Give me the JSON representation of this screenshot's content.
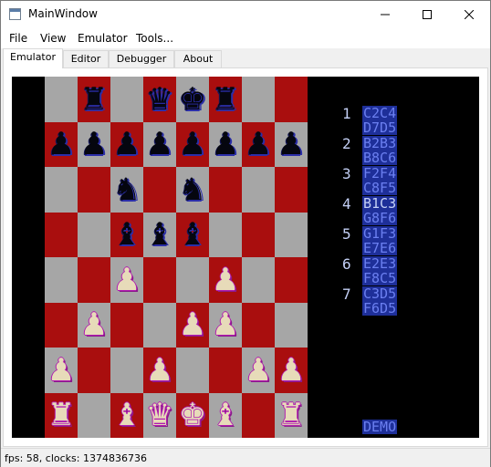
{
  "window": {
    "title": "MainWindow",
    "icons": {
      "minimize": "minimize-icon",
      "maximize": "maximize-icon",
      "close": "close-icon"
    }
  },
  "menu": [
    "File",
    "View",
    "Emulator",
    "Tools..."
  ],
  "tabs": [
    {
      "label": "Emulator",
      "active": true
    },
    {
      "label": "Editor",
      "active": false
    },
    {
      "label": "Debugger",
      "active": false
    },
    {
      "label": "About",
      "active": false
    }
  ],
  "status": {
    "text": "fps: 58, clocks: 1374836736"
  },
  "colors": {
    "light_square": "#a6a6a6",
    "dark_square": "#a90e0e",
    "move_text": "#6b7ff0",
    "move_bg": "#1e2f99"
  },
  "game": {
    "board": [
      ".r.qkr..",
      "pppppppp",
      "..n.n...",
      "..bbb...",
      "..P..P..",
      ".P..PP..",
      "P..P..PP",
      "R.BQKB.R"
    ],
    "moves": [
      {
        "num": "1",
        "white": "C2C4",
        "black": "D7D5"
      },
      {
        "num": "2",
        "white": "B2B3",
        "black": "B8C6"
      },
      {
        "num": "3",
        "white": "F2F4",
        "black": "C8F5"
      },
      {
        "num": "4",
        "white": "B1C3",
        "black": "G8F6"
      },
      {
        "num": "5",
        "white": "G1F3",
        "black": "E7E6"
      },
      {
        "num": "6",
        "white": "E2E3",
        "black": "F8C5"
      },
      {
        "num": "7",
        "white": "C3D5",
        "black": "F6D5"
      }
    ],
    "highlight": "B1C3",
    "mode": "DEMO"
  }
}
